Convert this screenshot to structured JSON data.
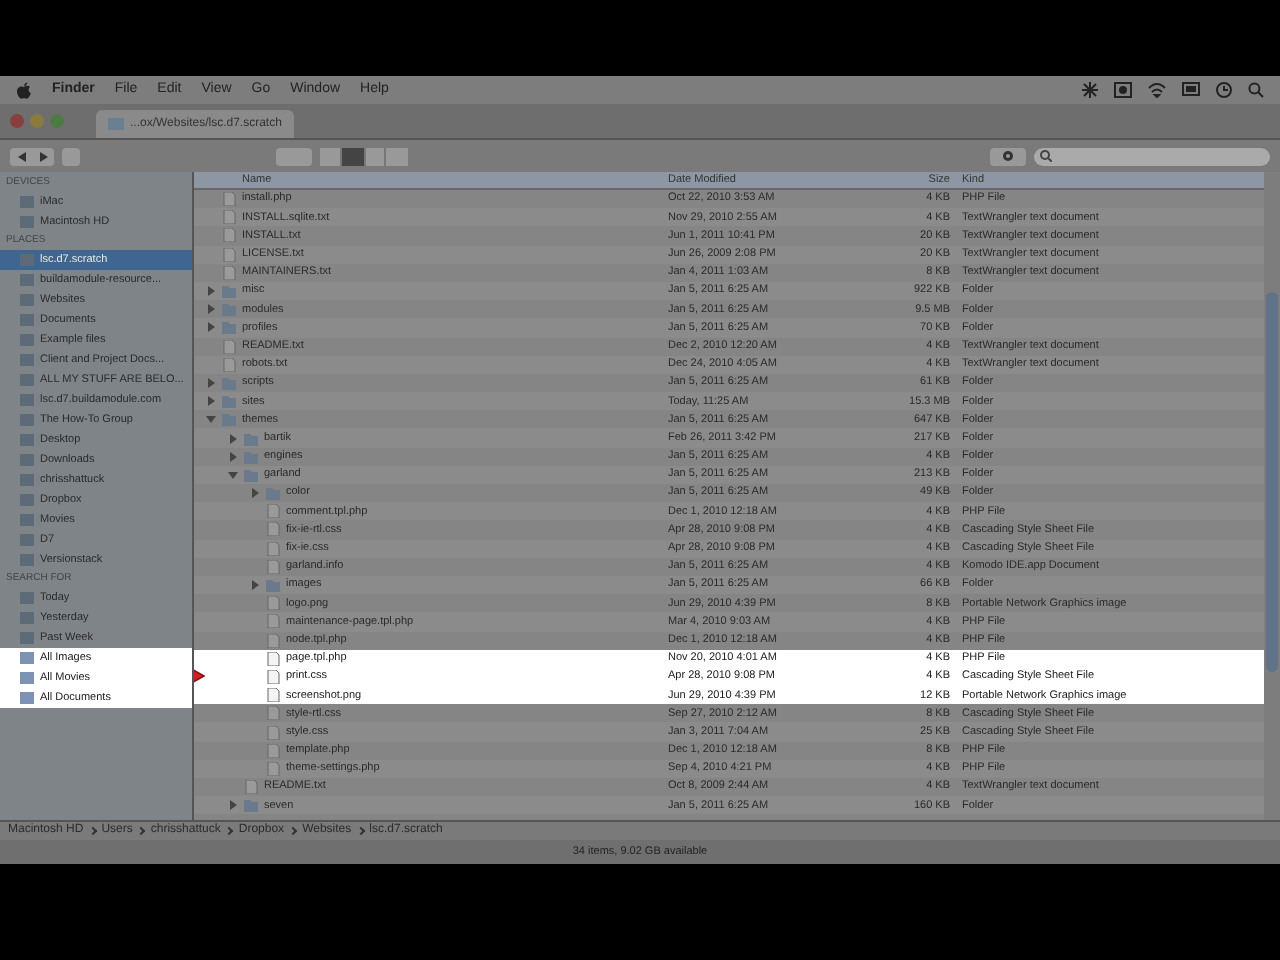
{
  "menu_bar": {
    "items": [
      "Finder",
      "File",
      "Edit",
      "View",
      "Go",
      "Window",
      "Help"
    ]
  },
  "window": {
    "title": "...ox/Websites/lsc.d7.scratch"
  },
  "sidebar": {
    "sections": [
      {
        "heading": "DEVICES",
        "items": [
          {
            "label": "iMac",
            "selected": false,
            "highlighted": false
          },
          {
            "label": "Macintosh HD",
            "selected": false,
            "highlighted": false
          }
        ]
      },
      {
        "heading": "PLACES",
        "items": [
          {
            "label": "lsc.d7.scratch",
            "selected": true,
            "highlighted": false
          },
          {
            "label": "buildamodule-resource...",
            "selected": false,
            "highlighted": false
          },
          {
            "label": "Websites",
            "selected": false,
            "highlighted": false
          },
          {
            "label": "Documents",
            "selected": false,
            "highlighted": false
          },
          {
            "label": "Example files",
            "selected": false,
            "highlighted": false
          },
          {
            "label": "Client and Project Docs...",
            "selected": false,
            "highlighted": false
          },
          {
            "label": "ALL MY STUFF ARE BELO...",
            "selected": false,
            "highlighted": false
          },
          {
            "label": "lsc.d7.buildamodule.com",
            "selected": false,
            "highlighted": false
          },
          {
            "label": "The How-To Group",
            "selected": false,
            "highlighted": false
          },
          {
            "label": "Desktop",
            "selected": false,
            "highlighted": false
          },
          {
            "label": "Downloads",
            "selected": false,
            "highlighted": false
          },
          {
            "label": "chrisshattuck",
            "selected": false,
            "highlighted": false
          },
          {
            "label": "Dropbox",
            "selected": false,
            "highlighted": false
          },
          {
            "label": "Movies",
            "selected": false,
            "highlighted": false
          },
          {
            "label": "D7",
            "selected": false,
            "highlighted": false
          },
          {
            "label": "Versionstack",
            "selected": false,
            "highlighted": false
          }
        ]
      },
      {
        "heading": "SEARCH FOR",
        "items": [
          {
            "label": "Today",
            "selected": false,
            "highlighted": false
          },
          {
            "label": "Yesterday",
            "selected": false,
            "highlighted": false
          },
          {
            "label": "Past Week",
            "selected": false,
            "highlighted": false
          },
          {
            "label": "All Images",
            "selected": false,
            "highlighted": true
          },
          {
            "label": "All Movies",
            "selected": false,
            "highlighted": true
          },
          {
            "label": "All Documents",
            "selected": false,
            "highlighted": true
          }
        ]
      }
    ]
  },
  "table": {
    "columns": [
      "Name",
      "Date Modified",
      "Size",
      "Kind"
    ],
    "rows": [
      {
        "name": "install.php",
        "date": "Oct 22, 2010 3:53 AM",
        "size": "4 KB",
        "file_kind": "PHP File",
        "highlighted": false,
        "pointer": false
      },
      {
        "name": "INSTALL.sqlite.txt",
        "date": "Nov 29, 2010 2:55 AM",
        "size": "4 KB",
        "file_kind": "TextWrangler text document",
        "highlighted": false,
        "pointer": false
      },
      {
        "name": "INSTALL.txt",
        "date": "Jun 1, 2011 10:41 PM",
        "size": "20 KB",
        "file_kind": "TextWrangler text document",
        "highlighted": false,
        "pointer": false
      },
      {
        "name": "LICENSE.txt",
        "date": "Jun 26, 2009 2:08 PM",
        "size": "20 KB",
        "file_kind": "TextWrangler text document",
        "highlighted": false,
        "pointer": false
      },
      {
        "name": "MAINTAINERS.txt",
        "date": "Jan 4, 2011 1:03 AM",
        "size": "8 KB",
        "file_kind": "TextWrangler text document",
        "highlighted": false,
        "pointer": false
      },
      {
        "name": "misc",
        "date": "Jan 5, 2011 6:25 AM",
        "size": "922 KB",
        "file_kind": "Folder",
        "expanded": false,
        "highlighted": false,
        "pointer": false
      },
      {
        "name": "modules",
        "date": "Jan 5, 2011 6:25 AM",
        "size": "9.5 MB",
        "file_kind": "Folder",
        "expanded": false,
        "highlighted": false,
        "pointer": false
      },
      {
        "name": "profiles",
        "date": "Jan 5, 2011 6:25 AM",
        "size": "70 KB",
        "file_kind": "Folder",
        "expanded": false,
        "highlighted": false,
        "pointer": false
      },
      {
        "name": "README.txt",
        "date": "Dec 2, 2010 12:20 AM",
        "size": "4 KB",
        "file_kind": "TextWrangler text document",
        "highlighted": false,
        "pointer": false
      },
      {
        "name": "robots.txt",
        "date": "Dec 24, 2010 4:05 AM",
        "size": "4 KB",
        "file_kind": "TextWrangler text document",
        "highlighted": false,
        "pointer": false
      },
      {
        "name": "scripts",
        "date": "Jan 5, 2011 6:25 AM",
        "size": "61 KB",
        "file_kind": "Folder",
        "expanded": false,
        "highlighted": false,
        "pointer": false
      },
      {
        "name": "sites",
        "date": "Today, 11:25 AM",
        "size": "15.3 MB",
        "file_kind": "Folder",
        "expanded": false,
        "highlighted": false,
        "pointer": false
      },
      {
        "name": "themes",
        "date": "Jan 5, 2011 6:25 AM",
        "size": "647 KB",
        "file_kind": "Folder",
        "expanded": true,
        "highlighted": false,
        "pointer": false,
        "children": [
          {
            "name": "bartik",
            "date": "Feb 26, 2011 3:42 PM",
            "size": "217 KB",
            "file_kind": "Folder",
            "expanded": false,
            "highlighted": false,
            "pointer": false
          },
          {
            "name": "engines",
            "date": "Jan 5, 2011 6:25 AM",
            "size": "4 KB",
            "file_kind": "Folder",
            "expanded": false,
            "highlighted": false,
            "pointer": false
          },
          {
            "name": "garland",
            "date": "Jan 5, 2011 6:25 AM",
            "size": "213 KB",
            "file_kind": "Folder",
            "expanded": true,
            "highlighted": false,
            "pointer": false,
            "children": [
              {
                "name": "color",
                "date": "Jan 5, 2011 6:25 AM",
                "size": "49 KB",
                "file_kind": "Folder",
                "expanded": false,
                "highlighted": false,
                "pointer": false
              },
              {
                "name": "comment.tpl.php",
                "date": "Dec 1, 2010 12:18 AM",
                "size": "4 KB",
                "file_kind": "PHP File",
                "highlighted": false,
                "pointer": false
              },
              {
                "name": "fix-ie-rtl.css",
                "date": "Apr 28, 2010 9:08 PM",
                "size": "4 KB",
                "file_kind": "Cascading Style Sheet File",
                "highlighted": false,
                "pointer": false
              },
              {
                "name": "fix-ie.css",
                "date": "Apr 28, 2010 9:08 PM",
                "size": "4 KB",
                "file_kind": "Cascading Style Sheet File",
                "highlighted": false,
                "pointer": false
              },
              {
                "name": "garland.info",
                "date": "Jan 5, 2011 6:25 AM",
                "size": "4 KB",
                "file_kind": "Komodo IDE.app Document",
                "highlighted": false,
                "pointer": false
              },
              {
                "name": "images",
                "date": "Jan 5, 2011 6:25 AM",
                "size": "66 KB",
                "file_kind": "Folder",
                "expanded": false,
                "highlighted": false,
                "pointer": false
              },
              {
                "name": "logo.png",
                "date": "Jun 29, 2010 4:39 PM",
                "size": "8 KB",
                "file_kind": "Portable Network Graphics image",
                "highlighted": false,
                "pointer": false
              },
              {
                "name": "maintenance-page.tpl.php",
                "date": "Mar 4, 2010 9:03 AM",
                "size": "4 KB",
                "file_kind": "PHP File",
                "highlighted": false,
                "pointer": false
              },
              {
                "name": "node.tpl.php",
                "date": "Dec 1, 2010 12:18 AM",
                "size": "4 KB",
                "file_kind": "PHP File",
                "highlighted": false,
                "pointer": false
              },
              {
                "name": "page.tpl.php",
                "date": "Nov 20, 2010 4:01 AM",
                "size": "4 KB",
                "file_kind": "PHP File",
                "highlighted": true,
                "pointer": false
              },
              {
                "name": "print.css",
                "date": "Apr 28, 2010 9:08 PM",
                "size": "4 KB",
                "file_kind": "Cascading Style Sheet File",
                "highlighted": true,
                "pointer": true
              },
              {
                "name": "screenshot.png",
                "date": "Jun 29, 2010 4:39 PM",
                "size": "12 KB",
                "file_kind": "Portable Network Graphics image",
                "highlighted": true,
                "pointer": false
              },
              {
                "name": "style-rtl.css",
                "date": "Sep 27, 2010 2:12 AM",
                "size": "8 KB",
                "file_kind": "Cascading Style Sheet File",
                "highlighted": false,
                "pointer": false
              },
              {
                "name": "style.css",
                "date": "Jan 3, 2011 7:04 AM",
                "size": "25 KB",
                "file_kind": "Cascading Style Sheet File",
                "highlighted": false,
                "pointer": false
              },
              {
                "name": "template.php",
                "date": "Dec 1, 2010 12:18 AM",
                "size": "8 KB",
                "file_kind": "PHP File",
                "highlighted": false,
                "pointer": false
              },
              {
                "name": "theme-settings.php",
                "date": "Sep 4, 2010 4:21 PM",
                "size": "4 KB",
                "file_kind": "PHP File",
                "highlighted": false,
                "pointer": false
              }
            ]
          },
          {
            "name": "README.txt",
            "date": "Oct 8, 2009 2:44 AM",
            "size": "4 KB",
            "file_kind": "TextWrangler text document",
            "highlighted": false,
            "pointer": false
          },
          {
            "name": "seven",
            "date": "Jan 5, 2011 6:25 AM",
            "size": "160 KB",
            "file_kind": "Folder",
            "expanded": false,
            "highlighted": false,
            "pointer": false
          }
        ]
      }
    ]
  },
  "path_bar": [
    "Macintosh HD",
    "Users",
    "chrisshattuck",
    "Dropbox",
    "Websites",
    "lsc.d7.scratch"
  ],
  "status_bar": "34 items, 9.02 GB available"
}
